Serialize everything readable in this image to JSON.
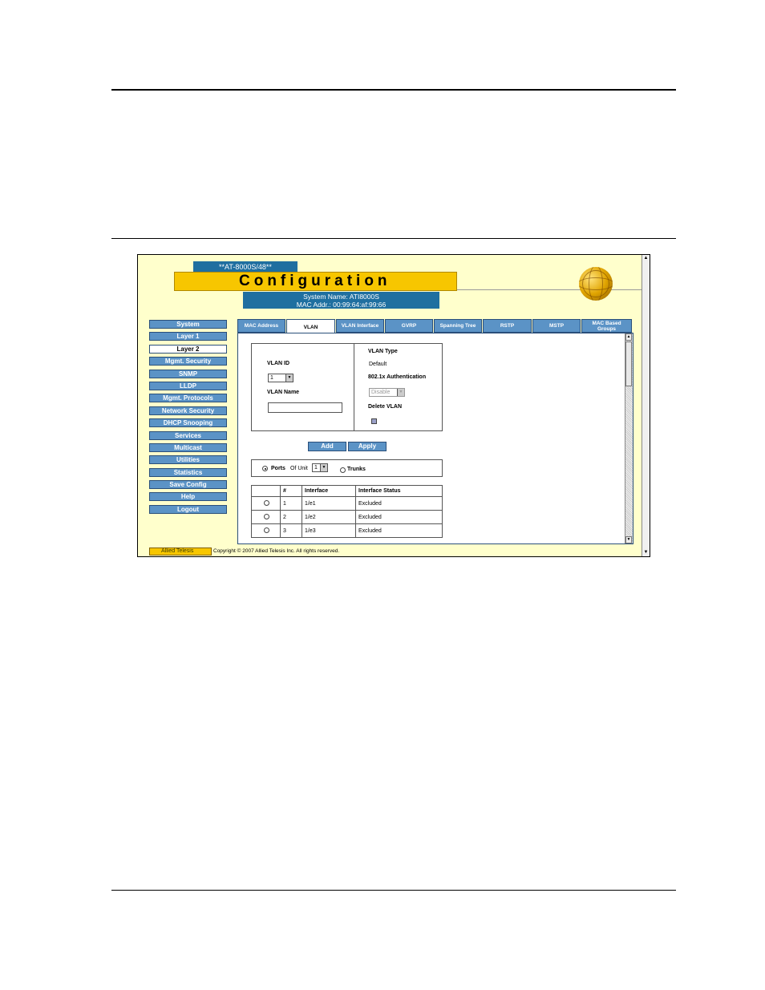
{
  "window": {
    "model": "**AT-8000S/48**",
    "title": "Configuration",
    "system_name": "System Name: ATI8000S",
    "mac_addr": "MAC Addr.: 00:99:64:af:99:66"
  },
  "nav": {
    "items": [
      {
        "label": "System",
        "active": false
      },
      {
        "label": "Layer 1",
        "active": false
      },
      {
        "label": "Layer 2",
        "active": true
      },
      {
        "label": "Mgmt. Security",
        "active": false
      },
      {
        "label": "SNMP",
        "active": false
      },
      {
        "label": "LLDP",
        "active": false
      },
      {
        "label": "Mgmt. Protocols",
        "active": false
      },
      {
        "label": "Network Security",
        "active": false
      },
      {
        "label": "DHCP Snooping",
        "active": false
      },
      {
        "label": "Services",
        "active": false
      },
      {
        "label": "Multicast",
        "active": false
      },
      {
        "label": "Utilities",
        "active": false
      },
      {
        "label": "Statistics",
        "active": false
      },
      {
        "label": "Save Config",
        "active": false
      },
      {
        "label": "Help",
        "active": false
      },
      {
        "label": "Logout",
        "active": false
      }
    ]
  },
  "tabs": [
    {
      "label": "MAC Address",
      "active": false
    },
    {
      "label": "VLAN",
      "active": true
    },
    {
      "label": "VLAN Interface",
      "active": false
    },
    {
      "label": "GVRP",
      "active": false
    },
    {
      "label": "Spanning Tree",
      "active": false
    },
    {
      "label": "RSTP",
      "active": false
    },
    {
      "label": "MSTP",
      "active": false
    },
    {
      "label": "MAC Based Groups",
      "active": false
    }
  ],
  "form": {
    "vlan_id_label": "VLAN ID",
    "vlan_id_value": "1",
    "vlan_name_label": "VLAN Name",
    "vlan_name_value": "",
    "vlan_type_label": "VLAN Type",
    "vlan_type_value": "Default",
    "auth_label": "802.1x Authentication",
    "auth_value": "Disable",
    "delete_label": "Delete VLAN",
    "add_label": "Add",
    "apply_label": "Apply"
  },
  "port_select": {
    "ports_label": "Ports",
    "of_unit_label": "Of Unit",
    "unit_value": "1",
    "trunks_label": "Trunks"
  },
  "table": {
    "headers": [
      "",
      "#",
      "Interface",
      "Interface Status"
    ],
    "rows": [
      {
        "num": "1",
        "interface": "1/e1",
        "status": "Excluded"
      },
      {
        "num": "2",
        "interface": "1/e2",
        "status": "Excluded"
      },
      {
        "num": "3",
        "interface": "1/e3",
        "status": "Excluded"
      }
    ]
  },
  "footer": {
    "logo_text": "Allied Telesis",
    "copyright": "Copyright © 2007 Allied Telesis Inc. All rights reserved."
  }
}
